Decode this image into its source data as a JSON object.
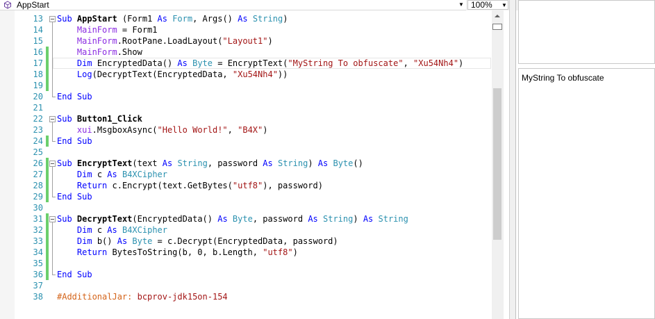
{
  "toolbar": {
    "member_selector": "AppStart",
    "zoom": "100%"
  },
  "editor": {
    "lines": [
      {
        "num": "13",
        "tokens": [
          {
            "t": "Sub",
            "c": "kw"
          },
          {
            "t": " "
          },
          {
            "t": "AppStart",
            "c": "bold"
          },
          {
            "t": " (Form1 "
          },
          {
            "t": "As",
            "c": "kw"
          },
          {
            "t": " "
          },
          {
            "t": "Form",
            "c": "ty"
          },
          {
            "t": ", Args() "
          },
          {
            "t": "As",
            "c": "kw"
          },
          {
            "t": " "
          },
          {
            "t": "String",
            "c": "ty"
          },
          {
            "t": ")"
          }
        ]
      },
      {
        "num": "14",
        "tokens": [
          {
            "t": "    "
          },
          {
            "t": "MainForm",
            "c": "gv"
          },
          {
            "t": " = Form1"
          }
        ]
      },
      {
        "num": "15",
        "tokens": [
          {
            "t": "    "
          },
          {
            "t": "MainForm",
            "c": "gv"
          },
          {
            "t": ".RootPane.LoadLayout("
          },
          {
            "t": "\"Layout1\"",
            "c": "str"
          },
          {
            "t": ")"
          }
        ]
      },
      {
        "num": "16",
        "tokens": [
          {
            "t": "    "
          },
          {
            "t": "MainForm",
            "c": "gv"
          },
          {
            "t": ".Show"
          }
        ]
      },
      {
        "num": "17",
        "tokens": [
          {
            "t": "    "
          },
          {
            "t": "Dim",
            "c": "kw"
          },
          {
            "t": " EncryptedData() "
          },
          {
            "t": "As",
            "c": "kw"
          },
          {
            "t": " "
          },
          {
            "t": "Byte",
            "c": "ty"
          },
          {
            "t": " = EncryptText("
          },
          {
            "t": "\"MyString To obfuscate\"",
            "c": "str"
          },
          {
            "t": ", "
          },
          {
            "t": "\"Xu54Nh4\"",
            "c": "str"
          },
          {
            "t": ")"
          }
        ]
      },
      {
        "num": "18",
        "tokens": [
          {
            "t": "    "
          },
          {
            "t": "Log",
            "c": "kw"
          },
          {
            "t": "(DecryptText(EncryptedData, "
          },
          {
            "t": "\"Xu54Nh4\"",
            "c": "str"
          },
          {
            "t": "))"
          }
        ]
      },
      {
        "num": "19",
        "tokens": []
      },
      {
        "num": "20",
        "tokens": [
          {
            "t": "End Sub",
            "c": "kw"
          }
        ]
      },
      {
        "num": "21",
        "tokens": []
      },
      {
        "num": "22",
        "tokens": [
          {
            "t": "Sub",
            "c": "kw"
          },
          {
            "t": " "
          },
          {
            "t": "Button1_Click",
            "c": "bold"
          }
        ]
      },
      {
        "num": "23",
        "tokens": [
          {
            "t": "    "
          },
          {
            "t": "xui",
            "c": "gv"
          },
          {
            "t": ".MsgboxAsync("
          },
          {
            "t": "\"Hello World!\"",
            "c": "str"
          },
          {
            "t": ", "
          },
          {
            "t": "\"B4X\"",
            "c": "str"
          },
          {
            "t": ")"
          }
        ]
      },
      {
        "num": "24",
        "tokens": [
          {
            "t": "End Sub",
            "c": "kw"
          }
        ]
      },
      {
        "num": "25",
        "tokens": []
      },
      {
        "num": "26",
        "tokens": [
          {
            "t": "Sub",
            "c": "kw"
          },
          {
            "t": " "
          },
          {
            "t": "EncryptText",
            "c": "bold"
          },
          {
            "t": "(text "
          },
          {
            "t": "As",
            "c": "kw"
          },
          {
            "t": " "
          },
          {
            "t": "String",
            "c": "ty"
          },
          {
            "t": ", password "
          },
          {
            "t": "As",
            "c": "kw"
          },
          {
            "t": " "
          },
          {
            "t": "String",
            "c": "ty"
          },
          {
            "t": ") "
          },
          {
            "t": "As",
            "c": "kw"
          },
          {
            "t": " "
          },
          {
            "t": "Byte",
            "c": "ty"
          },
          {
            "t": "()"
          }
        ]
      },
      {
        "num": "27",
        "tokens": [
          {
            "t": "    "
          },
          {
            "t": "Dim",
            "c": "kw"
          },
          {
            "t": " c "
          },
          {
            "t": "As",
            "c": "kw"
          },
          {
            "t": " "
          },
          {
            "t": "B4XCipher",
            "c": "ty"
          }
        ]
      },
      {
        "num": "28",
        "tokens": [
          {
            "t": "    "
          },
          {
            "t": "Return",
            "c": "kw"
          },
          {
            "t": " c.Encrypt(text.GetBytes("
          },
          {
            "t": "\"utf8\"",
            "c": "str"
          },
          {
            "t": "), password)"
          }
        ]
      },
      {
        "num": "29",
        "tokens": [
          {
            "t": "End Sub",
            "c": "kw"
          }
        ]
      },
      {
        "num": "30",
        "tokens": []
      },
      {
        "num": "31",
        "tokens": [
          {
            "t": "Sub",
            "c": "kw"
          },
          {
            "t": " "
          },
          {
            "t": "DecryptText",
            "c": "bold"
          },
          {
            "t": "(EncryptedData() "
          },
          {
            "t": "As",
            "c": "kw"
          },
          {
            "t": " "
          },
          {
            "t": "Byte",
            "c": "ty"
          },
          {
            "t": ", password "
          },
          {
            "t": "As",
            "c": "kw"
          },
          {
            "t": " "
          },
          {
            "t": "String",
            "c": "ty"
          },
          {
            "t": ") "
          },
          {
            "t": "As",
            "c": "kw"
          },
          {
            "t": " "
          },
          {
            "t": "String",
            "c": "ty"
          }
        ]
      },
      {
        "num": "32",
        "tokens": [
          {
            "t": "    "
          },
          {
            "t": "Dim",
            "c": "kw"
          },
          {
            "t": " c "
          },
          {
            "t": "As",
            "c": "kw"
          },
          {
            "t": " "
          },
          {
            "t": "B4XCipher",
            "c": "ty"
          }
        ]
      },
      {
        "num": "33",
        "tokens": [
          {
            "t": "    "
          },
          {
            "t": "Dim",
            "c": "kw"
          },
          {
            "t": " b() "
          },
          {
            "t": "As",
            "c": "kw"
          },
          {
            "t": " "
          },
          {
            "t": "Byte",
            "c": "ty"
          },
          {
            "t": " = c.Decrypt(EncryptedData, password)"
          }
        ]
      },
      {
        "num": "34",
        "tokens": [
          {
            "t": "    "
          },
          {
            "t": "Return",
            "c": "kw"
          },
          {
            "t": " BytesToString(b, 0, b.Length, "
          },
          {
            "t": "\"utf8\"",
            "c": "str"
          },
          {
            "t": ")"
          }
        ]
      },
      {
        "num": "35",
        "tokens": []
      },
      {
        "num": "36",
        "tokens": [
          {
            "t": "End Sub",
            "c": "kw"
          }
        ]
      },
      {
        "num": "37",
        "tokens": []
      },
      {
        "num": "38",
        "tokens": [
          {
            "t": "#AdditionalJar:",
            "c": "dir"
          },
          {
            "t": " "
          },
          {
            "t": "bcprov-jdk15on-154",
            "c": "str"
          }
        ]
      }
    ]
  },
  "log_panel": {
    "output": "MyString To obfuscate"
  }
}
